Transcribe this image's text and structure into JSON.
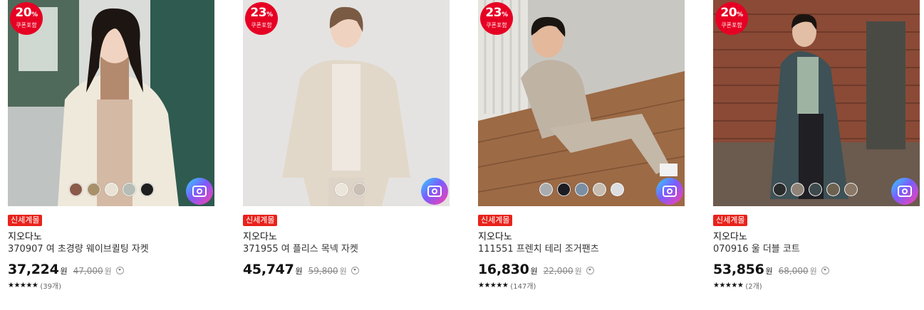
{
  "products": [
    {
      "badge": {
        "percent": "20",
        "unit": "%",
        "caption": "쿠폰포함"
      },
      "tag": "신세계몰",
      "brand": "지오다노",
      "name": "370907 여 초경량 웨이브퀼팅 자켓",
      "price": "37,224",
      "currency": "원",
      "original_price": "47,000",
      "stars": "★★★★★",
      "reviews": "(39개)",
      "swatch_colors": [
        "#8a5a4a",
        "#a8916a",
        "#e9e2d4",
        "#b6bdb6",
        "#1e1e1e"
      ],
      "icons": {
        "camera": "camera-icon",
        "info": "chevron-down-circle-icon"
      }
    },
    {
      "badge": {
        "percent": "23",
        "unit": "%",
        "caption": "쿠폰포함"
      },
      "tag": "신세계몰",
      "brand": "지오다노",
      "name": "371955 여 플리스 목넥 자켓",
      "price": "45,747",
      "currency": "원",
      "original_price": "59,800",
      "stars": "",
      "reviews": "",
      "swatch_colors": [
        "#ebe5da",
        "#c9bfb4"
      ],
      "icons": {
        "camera": "camera-icon",
        "info": "chevron-down-circle-icon"
      }
    },
    {
      "badge": {
        "percent": "23",
        "unit": "%",
        "caption": "쿠폰포함"
      },
      "tag": "신세계몰",
      "brand": "지오다노",
      "name": "111551 프렌치 테리 조거팬츠",
      "price": "16,830",
      "currency": "원",
      "original_price": "22,000",
      "stars": "★★★★★",
      "reviews": "(147개)",
      "swatch_colors": [
        "#a9acaf",
        "#1b1d22",
        "#7c8ea3",
        "#c6bdb0",
        "#dcdde0"
      ],
      "icons": {
        "camera": "camera-icon",
        "info": "chevron-down-circle-icon"
      }
    },
    {
      "badge": {
        "percent": "20",
        "unit": "%",
        "caption": "쿠폰포함"
      },
      "tag": "신세계몰",
      "brand": "지오다노",
      "name": "070916 울 더블 코트",
      "price": "53,856",
      "currency": "원",
      "original_price": "68,000",
      "stars": "★★★★★",
      "reviews": "(2개)",
      "swatch_colors": [
        "#2a2c2c",
        "#8f8378",
        "#3c4a4c",
        "#6d6250",
        "#8b7866"
      ],
      "icons": {
        "camera": "camera-icon",
        "info": "chevron-down-circle-icon"
      }
    }
  ]
}
